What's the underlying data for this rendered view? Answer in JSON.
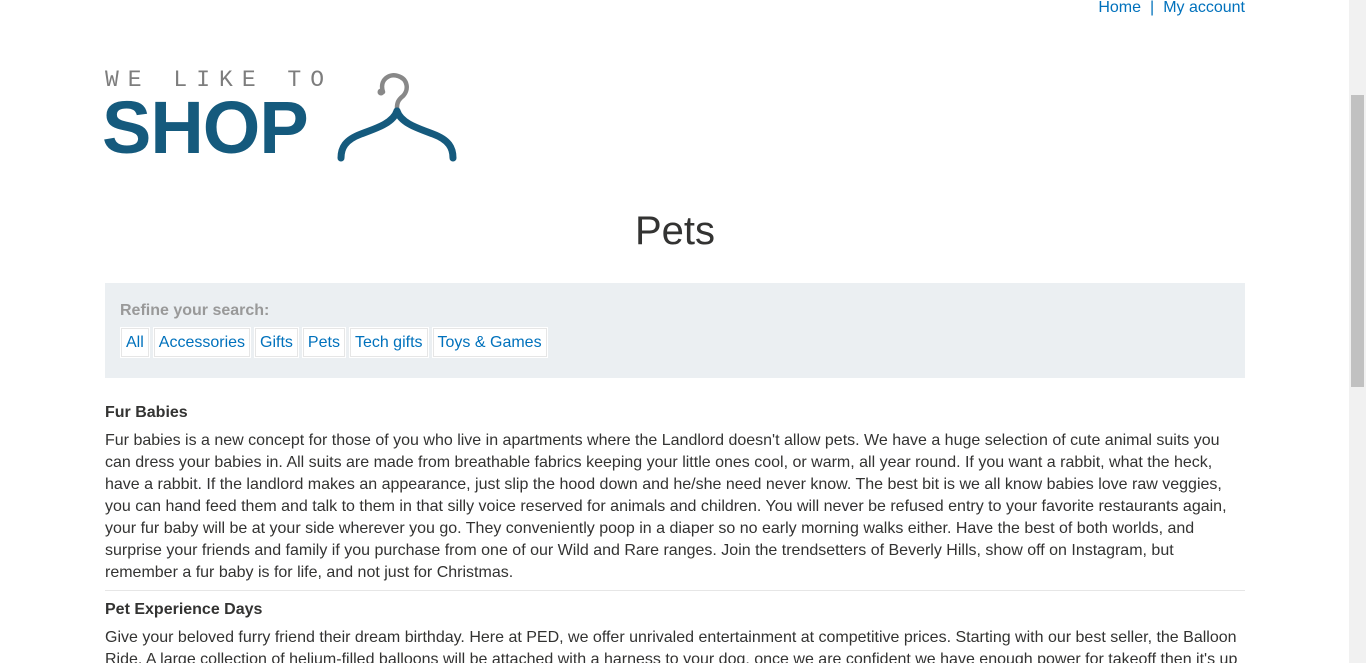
{
  "nav": {
    "home": "Home",
    "separator": "|",
    "my_account": "My account"
  },
  "logo": {
    "tagline": "WE LIKE TO",
    "word": "SHOP",
    "icon": "hanger-icon",
    "colors": {
      "word": "#155a7d",
      "tagline": "#7d7d7d",
      "hook": "#888888"
    }
  },
  "page_title": "Pets",
  "filters": {
    "label": "Refine your search:",
    "items": [
      {
        "label": "All"
      },
      {
        "label": "Accessories"
      },
      {
        "label": "Gifts"
      },
      {
        "label": "Pets"
      },
      {
        "label": "Tech gifts"
      },
      {
        "label": "Toys & Games"
      }
    ]
  },
  "products": [
    {
      "title": "Fur Babies",
      "description": "Fur babies is a new concept for those of you who live in apartments where the Landlord doesn't allow pets. We have a huge selection of cute animal suits you can dress your babies in. All suits are made from breathable fabrics keeping your little ones cool, or warm, all year round. If you want a rabbit, what the heck, have a rabbit. If the landlord makes an appearance, just slip the hood down and he/she need never know. The best bit is we all know babies love raw veggies, you can hand feed them and talk to them in that silly voice reserved for animals and children. You will never be refused entry to your favorite restaurants again, your fur baby will be at your side wherever you go. They conveniently poop in a diaper so no early morning walks either. Have the best of both worlds, and surprise your friends and family if you purchase from one of our Wild and Rare ranges. Join the trendsetters of Beverly Hills, show off on Instagram, but remember a fur baby is for life, and not just for Christmas."
    },
    {
      "title": "Pet Experience Days",
      "description": "Give your beloved furry friend their dream birthday. Here at PED, we offer unrivaled entertainment at competitive prices. Starting with our best seller, the Balloon Ride. A large collection of helium-filled balloons will be attached with a harness to your dog, once we are confident we have enough power for takeoff then it's up"
    }
  ],
  "colors": {
    "link": "#0071bc",
    "text": "#333332",
    "filter_bg": "#ebeff2",
    "filter_label": "#999999"
  }
}
